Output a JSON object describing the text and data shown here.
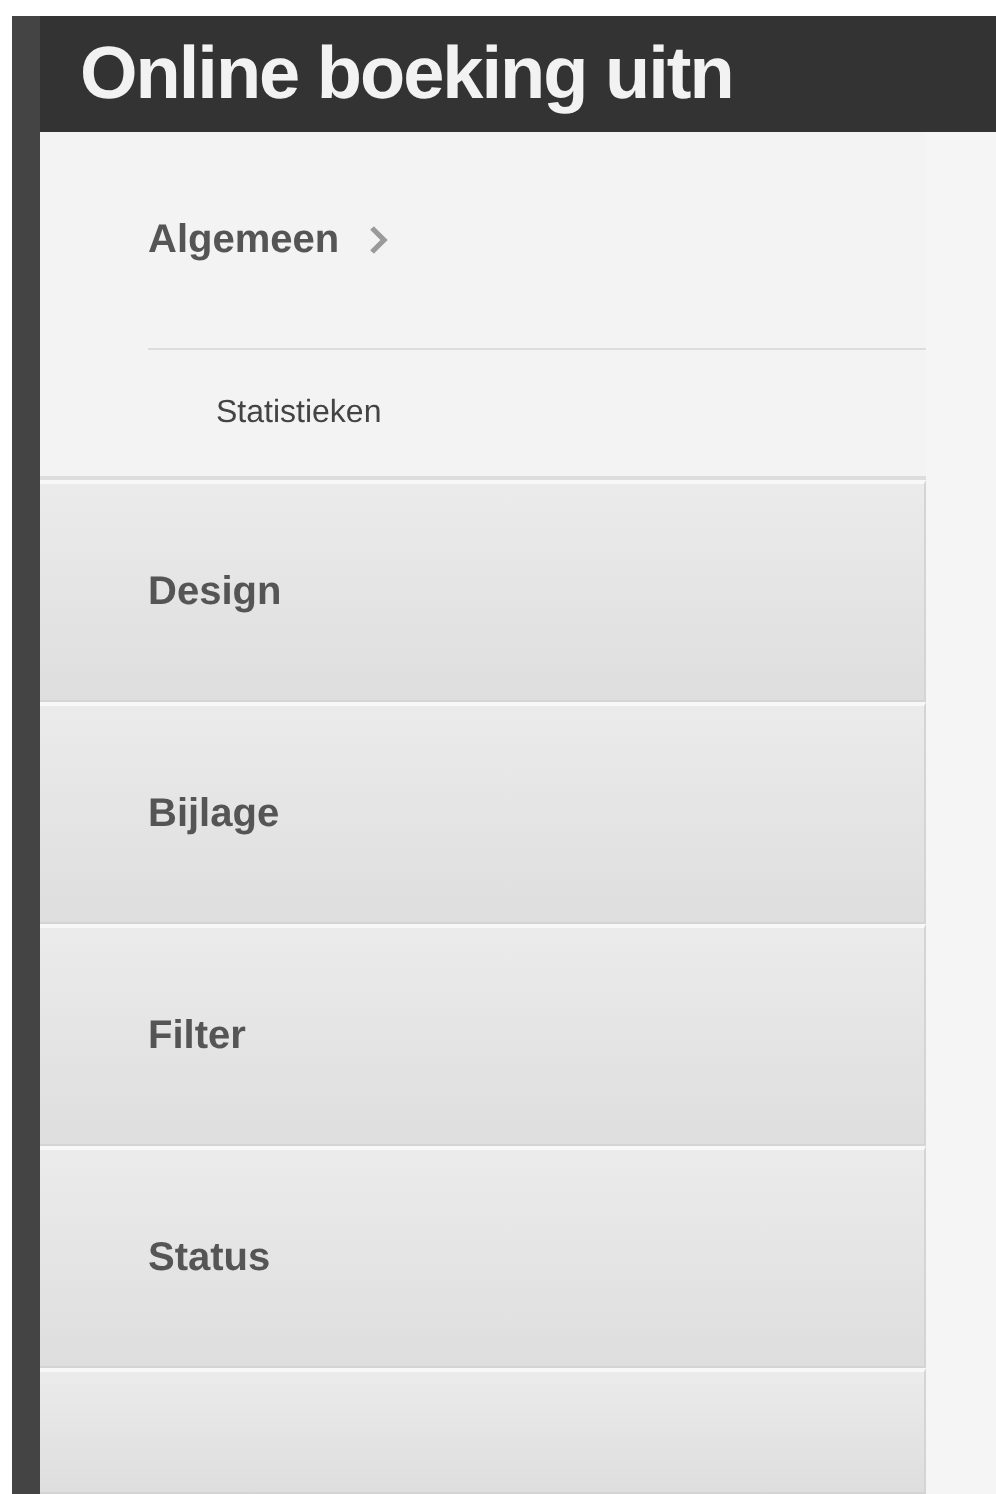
{
  "header": {
    "title": "Online boeking uitn"
  },
  "sidebar": {
    "items": [
      {
        "label": "Algemeen",
        "expanded": true,
        "children": [
          {
            "label": "Statistieken"
          }
        ]
      },
      {
        "label": "Design",
        "expanded": false
      },
      {
        "label": "Bijlage",
        "expanded": false
      },
      {
        "label": "Filter",
        "expanded": false
      },
      {
        "label": "Status",
        "expanded": false
      }
    ]
  }
}
